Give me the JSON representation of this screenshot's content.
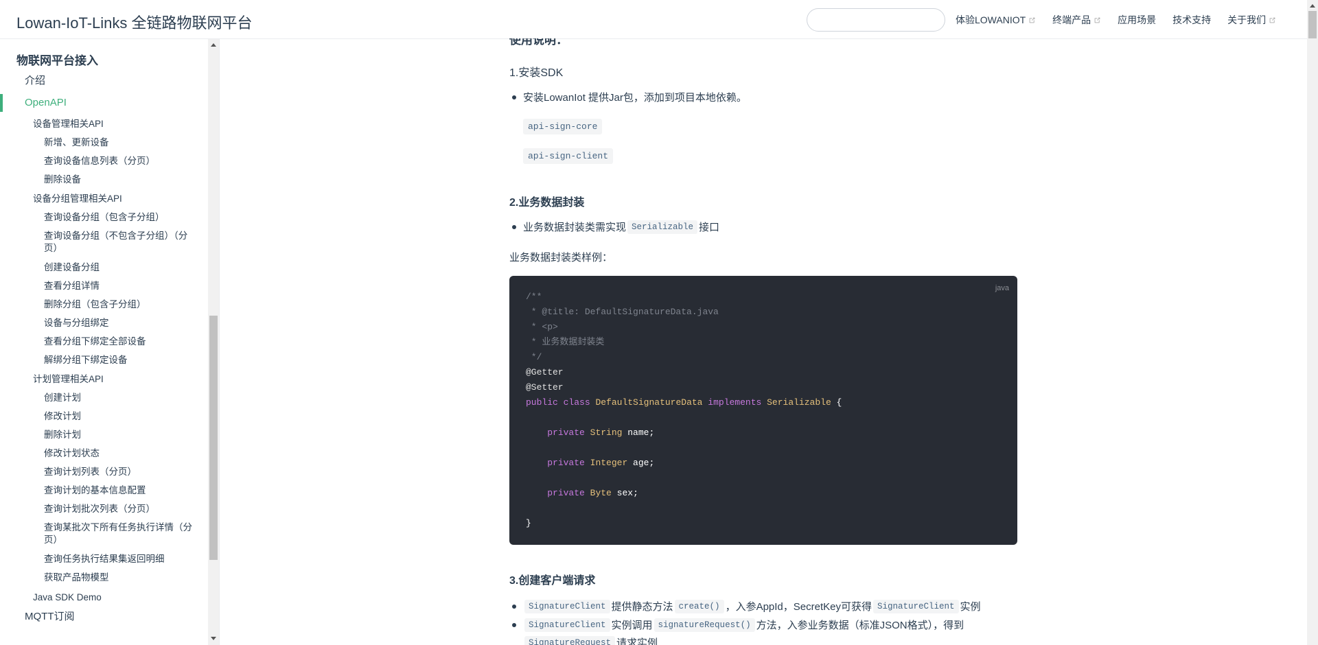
{
  "navbar": {
    "site_name": "Lowan-IoT-Links 全链路物联网平台",
    "search": {
      "value": "",
      "placeholder": ""
    },
    "links": [
      {
        "label": "体验LOWANIOT",
        "external": true
      },
      {
        "label": "终端产品",
        "external": true
      },
      {
        "label": "应用场景",
        "external": false
      },
      {
        "label": "技术支持",
        "external": false
      },
      {
        "label": "关于我们",
        "external": true
      }
    ]
  },
  "sidebar": {
    "heading": "物联网平台接入",
    "items": [
      {
        "label": "介绍"
      },
      {
        "label": "OpenAPI",
        "active": true
      },
      {
        "label": "设备管理相关API"
      },
      {
        "label": "新增、更新设备"
      },
      {
        "label": "查询设备信息列表（分页）"
      },
      {
        "label": "删除设备"
      },
      {
        "label": "设备分组管理相关API"
      },
      {
        "label": "查询设备分组（包含子分组）"
      },
      {
        "label": "查询设备分组（不包含子分组）（分页）"
      },
      {
        "label": "创建设备分组"
      },
      {
        "label": "查看分组详情"
      },
      {
        "label": "删除分组（包含子分组）"
      },
      {
        "label": "设备与分组绑定"
      },
      {
        "label": "查看分组下绑定全部设备"
      },
      {
        "label": "解绑分组下绑定设备"
      },
      {
        "label": "计划管理相关API"
      },
      {
        "label": "创建计划"
      },
      {
        "label": "修改计划"
      },
      {
        "label": "删除计划"
      },
      {
        "label": "修改计划状态"
      },
      {
        "label": "查询计划列表（分页）"
      },
      {
        "label": "查询计划的基本信息配置"
      },
      {
        "label": "查询计划批次列表（分页）"
      },
      {
        "label": "查询某批次下所有任务执行详情（分页）"
      },
      {
        "label": "查询任务执行结果集返回明细"
      },
      {
        "label": "获取产品物模型"
      },
      {
        "label": "Java SDK Demo"
      },
      {
        "label": "MQTT订阅"
      }
    ]
  },
  "content": {
    "cut_heading": "使用说明：",
    "step1": {
      "title": "1.安装SDK",
      "bullet": "安装LowanIot 提供Jar包，添加到项目本地依赖。",
      "jars": [
        "api-sign-core",
        "api-sign-client"
      ]
    },
    "step2": {
      "title": "2.业务数据封装",
      "bullet_pre": "业务数据封装类需实现",
      "bullet_code": "Serializable",
      "bullet_post": "接口",
      "example_label": "业务数据封装类样例："
    },
    "code": {
      "lang": "java",
      "line1": "/**",
      "line2": " * @title: DefaultSignatureData.java",
      "line3": " * <p>",
      "line4": " * 业务数据封装类",
      "line5": " */",
      "line6": "@Getter",
      "line7": "@Setter",
      "kw_public": "public",
      "kw_class": "class",
      "class_name": "DefaultSignatureData",
      "kw_implements": "implements",
      "iface": "Serializable",
      "brace_open": " {",
      "kw_private": "private",
      "type_string": "String",
      "field_name": " name;",
      "type_integer": "Integer",
      "field_age": " age;",
      "type_byte": "Byte",
      "field_sex": " sex;",
      "brace_close": "}"
    },
    "step3": {
      "title": "3.创建客户端请求",
      "b1_code1": "SignatureClient",
      "b1_text1": "提供静态方法",
      "b1_code2": "create()",
      "b1_text2": "，入参AppId，SecretKey可获得",
      "b1_code3": "SignatureClient",
      "b1_text3": "实例",
      "b2_code1": "SignatureClient",
      "b2_text1": "实例调用",
      "b2_code2": "signatureRequest()",
      "b2_text2": "方法，入参业务数据（标准JSON格式），得到",
      "b3_code1": "SignatureRequest",
      "b3_text1": "请求实例"
    }
  }
}
